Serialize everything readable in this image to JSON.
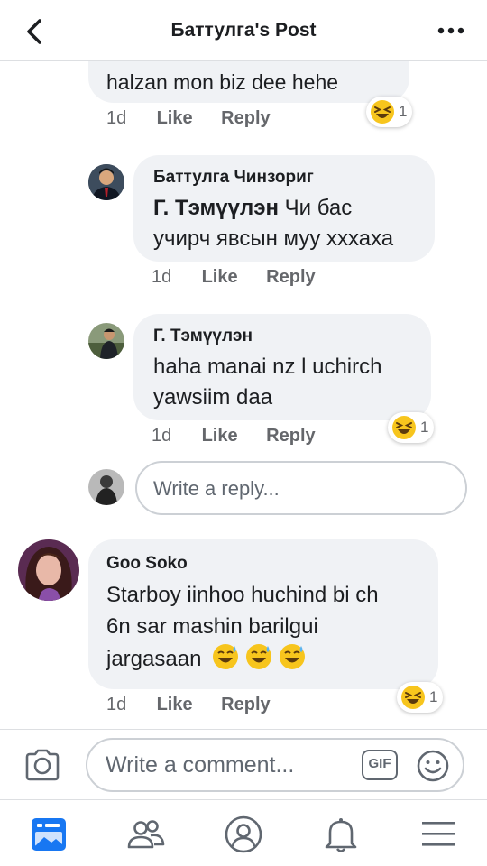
{
  "header": {
    "title": "Баттулга's Post"
  },
  "comments": [
    {
      "text": "halzan mon biz dee hehe",
      "time": "1d",
      "like": "Like",
      "reply": "Reply",
      "reaction_count": "1"
    },
    {
      "author": "Баттулга Чинзориг",
      "mention": "Г. Тэмүүлэн",
      "text_line1": "Чи бас",
      "text_line2": "учирч явсын муу хххаха",
      "time": "1d",
      "like": "Like",
      "reply": "Reply"
    },
    {
      "author": "Г. Тэмүүлэн",
      "text_line1": "haha manai nz l uchirch",
      "text_line2": "yawsiim daa",
      "time": "1d",
      "like": "Like",
      "reply": "Reply",
      "reaction_count": "1"
    },
    {
      "author": "Goo Soko",
      "text_line1": "Starboy iinhoo huchind bi ch",
      "text_line2": "6n sar mashin barilgui",
      "text_line3": "jargasaan",
      "time": "1d",
      "like": "Like",
      "reply": "Reply",
      "reaction_count": "1"
    }
  ],
  "reply_input": {
    "placeholder": "Write a reply..."
  },
  "composer": {
    "placeholder": "Write a comment...",
    "gif_label": "GIF"
  },
  "tabs": [
    "news-feed",
    "friends",
    "profile",
    "notifications",
    "menu"
  ],
  "colors": {
    "accent": "#1877f2",
    "bubble": "#f0f2f5",
    "meta": "#65676b"
  }
}
